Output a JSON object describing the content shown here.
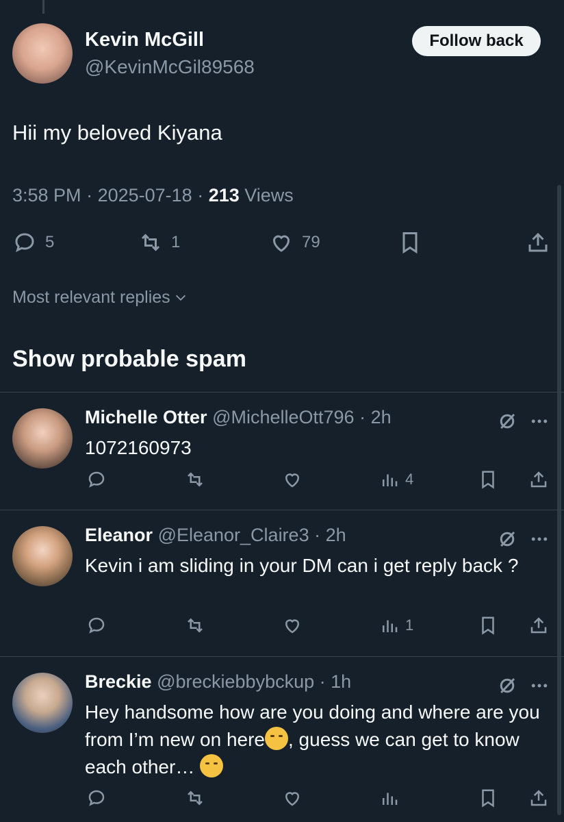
{
  "tweet": {
    "author_name": "Kevin McGill",
    "author_handle": "@KevinMcGil89568",
    "follow_label": "Follow back",
    "text": "Hii my beloved Kiyana",
    "time": "3:58 PM",
    "date": "2025-07-18",
    "views_count": "213",
    "views_label": "Views",
    "replies": "5",
    "retweets": "1",
    "likes": "79"
  },
  "sort_label": "Most relevant replies",
  "spam_heading": "Show probable spam",
  "replies": [
    {
      "name": "Michelle Otter",
      "handle": "@MichelleOtt796",
      "time": "2h",
      "text": "1072160973",
      "views": "4"
    },
    {
      "name": "Eleanor",
      "handle": "@Eleanor_Claire3",
      "time": "2h",
      "text": "Kevin i am sliding in your DM can i get reply back ?",
      "views": "1"
    },
    {
      "name": "Breckie",
      "handle": "@breckiebbybckup",
      "time": "1h",
      "text_1": "Hey handsome how are you doing and where are you from I’m new on here",
      "text_2": ", guess we can get to know each other…",
      "views": ""
    }
  ],
  "icons": {
    "reply": "reply-icon",
    "retweet": "retweet-icon",
    "like": "like-icon",
    "bookmark": "bookmark-icon",
    "share": "share-icon",
    "views": "views-icon",
    "grok": "grok-icon",
    "more": "more-icon"
  },
  "colors": {
    "background": "#15202b",
    "text": "#f7f9f9",
    "muted": "#8b98a5",
    "divider": "#38444d",
    "button_bg": "#eff3f4"
  }
}
